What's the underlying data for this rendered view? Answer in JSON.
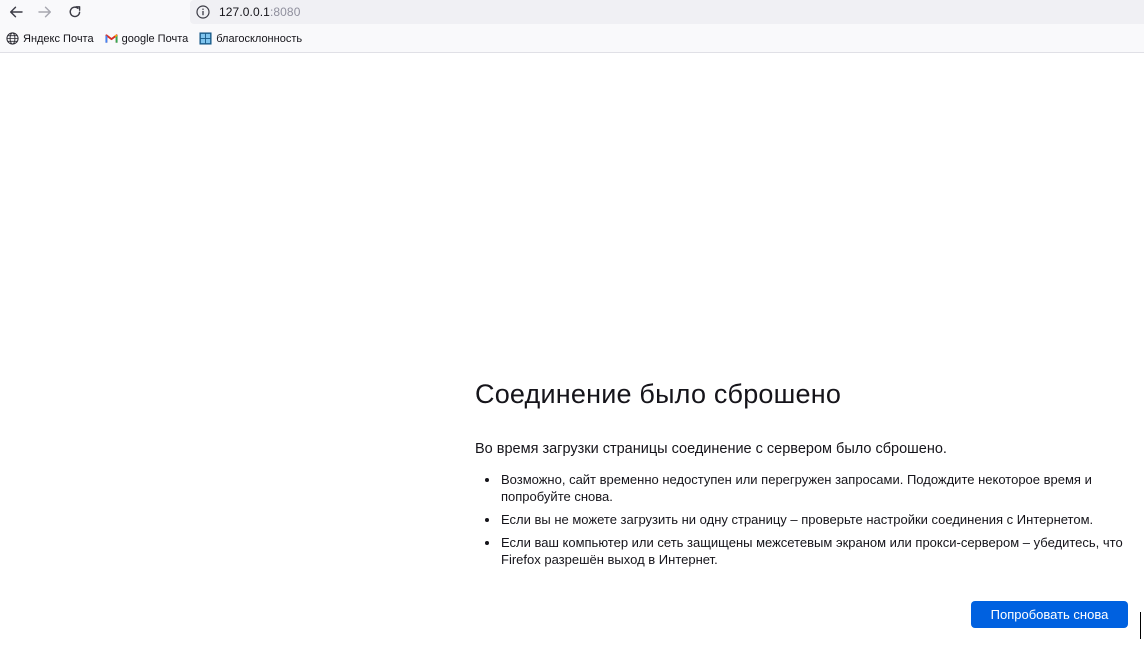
{
  "toolbar": {
    "back_icon": "arrow-left-icon",
    "forward_icon": "arrow-right-icon",
    "reload_icon": "reload-icon",
    "site_info_icon": "info-icon",
    "url_host": "127.0.0.1",
    "url_port": ":8080"
  },
  "bookmarks": [
    {
      "label": "Яндекс Почта",
      "icon": "globe-icon"
    },
    {
      "label": "google Почта",
      "icon": "gmail-icon"
    },
    {
      "label": "благосклонность",
      "icon": "windows-tiles-icon"
    }
  ],
  "error": {
    "title": "Соединение было сброшено",
    "intro": "Во время загрузки страницы соединение с сервером было сброшено.",
    "items": [
      "Возможно, сайт временно недоступен или перегружен запросами. Подождите некоторое время и попробуйте снова.",
      "Если вы не можете загрузить ни одну страницу – проверьте настройки соединения с Интернетом.",
      "Если ваш компьютер или сеть защищены межсетевым экраном или прокси-сервером – убедитесь, что Firefox разрешён выход в Интернет."
    ],
    "retry_label": "Попробовать снова"
  },
  "colors": {
    "accent": "#0061e0",
    "toolbar_bg": "#f9f9fb",
    "urlbar_bg": "#f0f0f4",
    "text": "#15141a",
    "muted_text": "#8f8f9d"
  }
}
